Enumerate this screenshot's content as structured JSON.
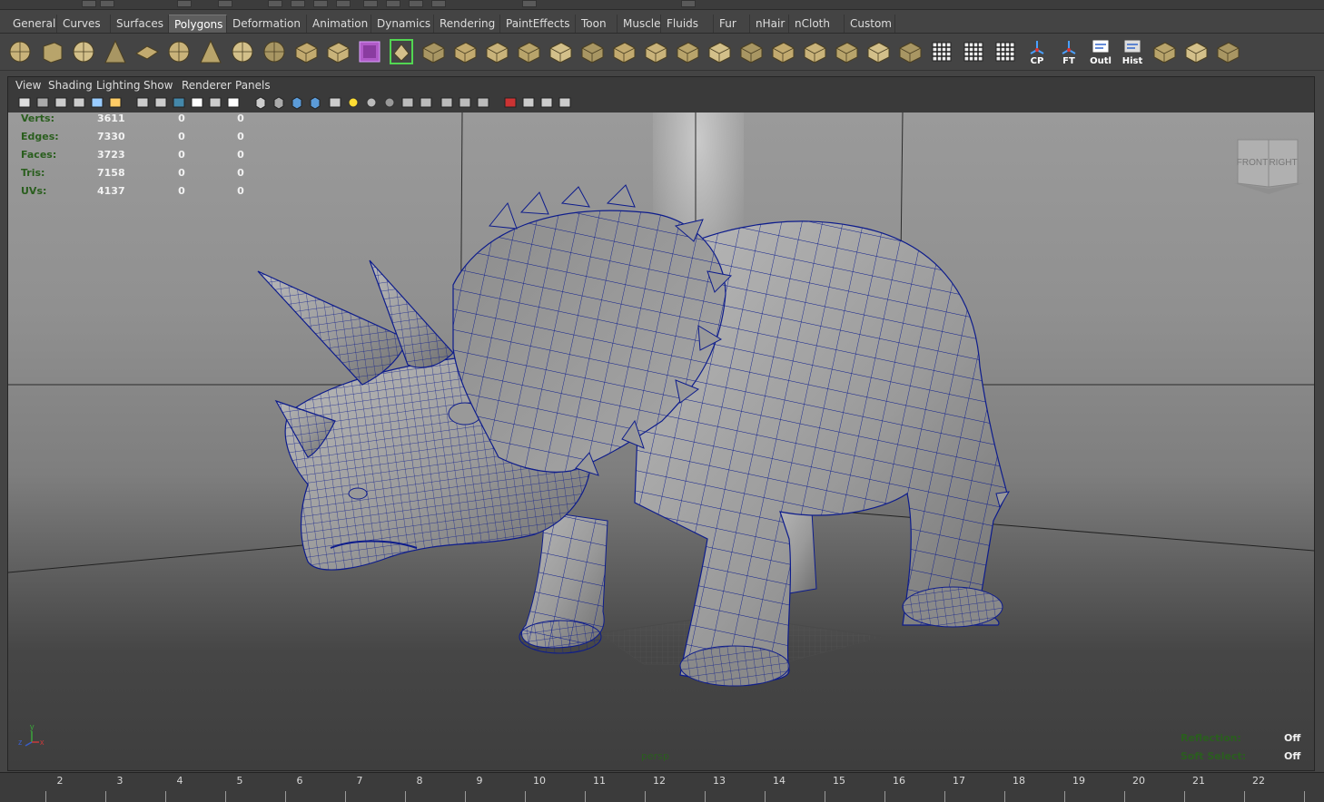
{
  "shelf_tabs": [
    {
      "label": "General"
    },
    {
      "label": "Curves"
    },
    {
      "label": "Surfaces"
    },
    {
      "label": "Polygons",
      "active": true
    },
    {
      "label": "Deformation"
    },
    {
      "label": "Animation"
    },
    {
      "label": "Dynamics"
    },
    {
      "label": "Rendering"
    },
    {
      "label": "PaintEffects"
    },
    {
      "label": "Toon"
    },
    {
      "label": "Muscle"
    },
    {
      "label": "Fluids"
    },
    {
      "label": "Fur"
    },
    {
      "label": "nHair"
    },
    {
      "label": "nCloth"
    },
    {
      "label": "Custom"
    }
  ],
  "shelf_icons": [
    {
      "name": "poly-sphere-icon"
    },
    {
      "name": "poly-cube-icon"
    },
    {
      "name": "poly-cylinder-icon"
    },
    {
      "name": "poly-cone-icon"
    },
    {
      "name": "poly-plane-icon"
    },
    {
      "name": "poly-torus-icon"
    },
    {
      "name": "poly-pyramid-icon"
    },
    {
      "name": "poly-pipe-icon"
    },
    {
      "name": "poly-soccerball-icon"
    },
    {
      "name": "split-polygon-icon"
    },
    {
      "name": "combine-icon"
    },
    {
      "name": "separate-icon"
    },
    {
      "name": "smooth-icon"
    },
    {
      "name": "bridge-icon"
    },
    {
      "name": "select-faces-icon"
    },
    {
      "name": "extrude-icon"
    },
    {
      "name": "append-polygon-icon"
    },
    {
      "name": "bevel-icon"
    },
    {
      "name": "wedge-face-icon"
    },
    {
      "name": "merge-vertices-icon"
    },
    {
      "name": "fill-hole-icon"
    },
    {
      "name": "split-edge-icon"
    },
    {
      "name": "poke-face-icon"
    },
    {
      "name": "duplicate-face-icon"
    },
    {
      "name": "extract-icon"
    },
    {
      "name": "planar-map-icon"
    },
    {
      "name": "cylindrical-map-icon"
    },
    {
      "name": "uv-pin-icon"
    },
    {
      "name": "checker-map-icon"
    },
    {
      "name": "uv-snapshot-icon"
    },
    {
      "name": "automatic-map-icon"
    },
    {
      "name": "checker-icon"
    },
    {
      "name": "cp-icon",
      "label": "CP"
    },
    {
      "name": "ft-icon",
      "label": "FT"
    },
    {
      "name": "outliner-icon",
      "label": "Outl"
    },
    {
      "name": "history-icon",
      "label": "Hist"
    },
    {
      "name": "layout-icon"
    },
    {
      "name": "render-settings-icon"
    },
    {
      "name": "grid-icon"
    }
  ],
  "panel_menu": [
    "View",
    "Shading",
    "Lighting",
    "Show",
    "Renderer",
    "Panels"
  ],
  "poly_count": {
    "rows": [
      {
        "label": "Verts:",
        "total": "3611",
        "selected": "0",
        "third": "0"
      },
      {
        "label": "Edges:",
        "total": "7330",
        "selected": "0",
        "third": "0"
      },
      {
        "label": "Faces:",
        "total": "3723",
        "selected": "0",
        "third": "0"
      },
      {
        "label": "Tris:",
        "total": "7158",
        "selected": "0",
        "third": "0"
      },
      {
        "label": "UVs:",
        "total": "4137",
        "selected": "0",
        "third": "0"
      }
    ]
  },
  "viewcube": {
    "front": "FRONT",
    "right": "RIGHT"
  },
  "camera_label": "persp",
  "axis": {
    "x": "x",
    "y": "y",
    "z": "z"
  },
  "hud_status": [
    {
      "label": "Reflection:",
      "value": "Off"
    },
    {
      "label": "Soft Select:",
      "value": "Off"
    }
  ],
  "timeline": {
    "ticks": [
      "2",
      "3",
      "4",
      "5",
      "6",
      "7",
      "8",
      "9",
      "10",
      "11",
      "12",
      "13",
      "14",
      "15",
      "16",
      "17",
      "18",
      "19",
      "20",
      "21",
      "22"
    ]
  },
  "colors": {
    "wire": "#0d1c8c",
    "hud_label": "#2a5e1e",
    "hud_value": "#f2f2f2"
  }
}
